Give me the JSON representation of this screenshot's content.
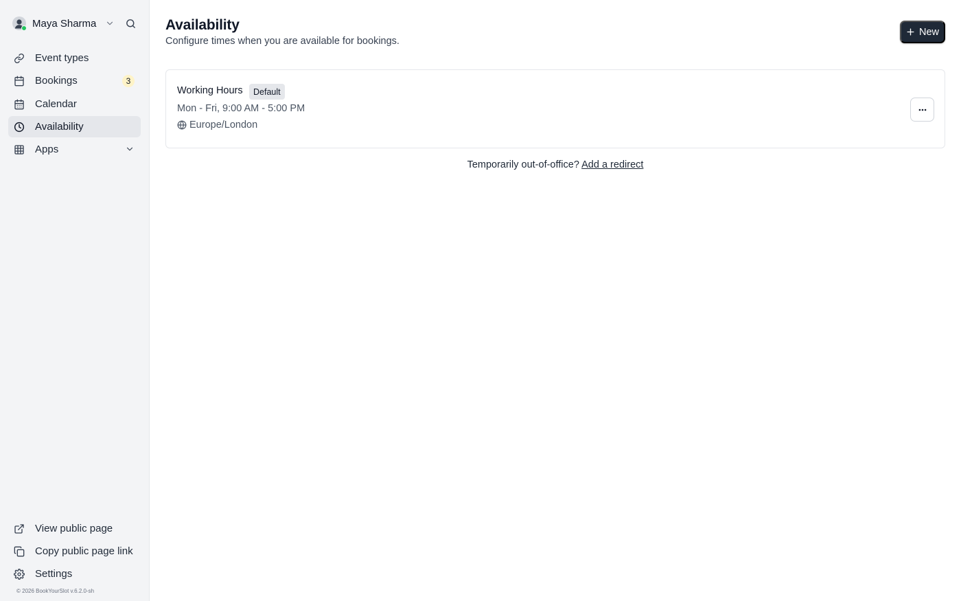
{
  "user": {
    "name": "Maya Sharma"
  },
  "sidebar": {
    "items": [
      {
        "label": "Event types",
        "icon": "link-icon"
      },
      {
        "label": "Bookings",
        "icon": "calendar-icon",
        "badge": "3"
      },
      {
        "label": "Calendar",
        "icon": "calendar-grid-icon"
      },
      {
        "label": "Availability",
        "icon": "clock-icon",
        "active": true
      },
      {
        "label": "Apps",
        "icon": "grid-icon"
      }
    ],
    "bottom_items": [
      {
        "label": "View public page",
        "icon": "external-link-icon"
      },
      {
        "label": "Copy public page link",
        "icon": "copy-icon"
      },
      {
        "label": "Settings",
        "icon": "gear-icon"
      }
    ],
    "footer": "© 2026 BookYourSlot v.6.2.0-sh"
  },
  "header": {
    "title": "Availability",
    "subtitle": "Configure times when you are available for bookings.",
    "new_label": "New"
  },
  "schedule": {
    "title": "Working Hours",
    "badge": "Default",
    "hours": "Mon - Fri, 9:00 AM - 5:00 PM",
    "timezone": "Europe/London"
  },
  "out_of_office": {
    "text": "Temporarily out-of-office?",
    "link": "Add a redirect"
  },
  "colors": {
    "sidebar_bg": "#f3f4f6",
    "active_bg": "#e5e7eb",
    "primary_button": "#1f2937",
    "badge_bg": "#fef3c7",
    "online": "#22c55e"
  }
}
